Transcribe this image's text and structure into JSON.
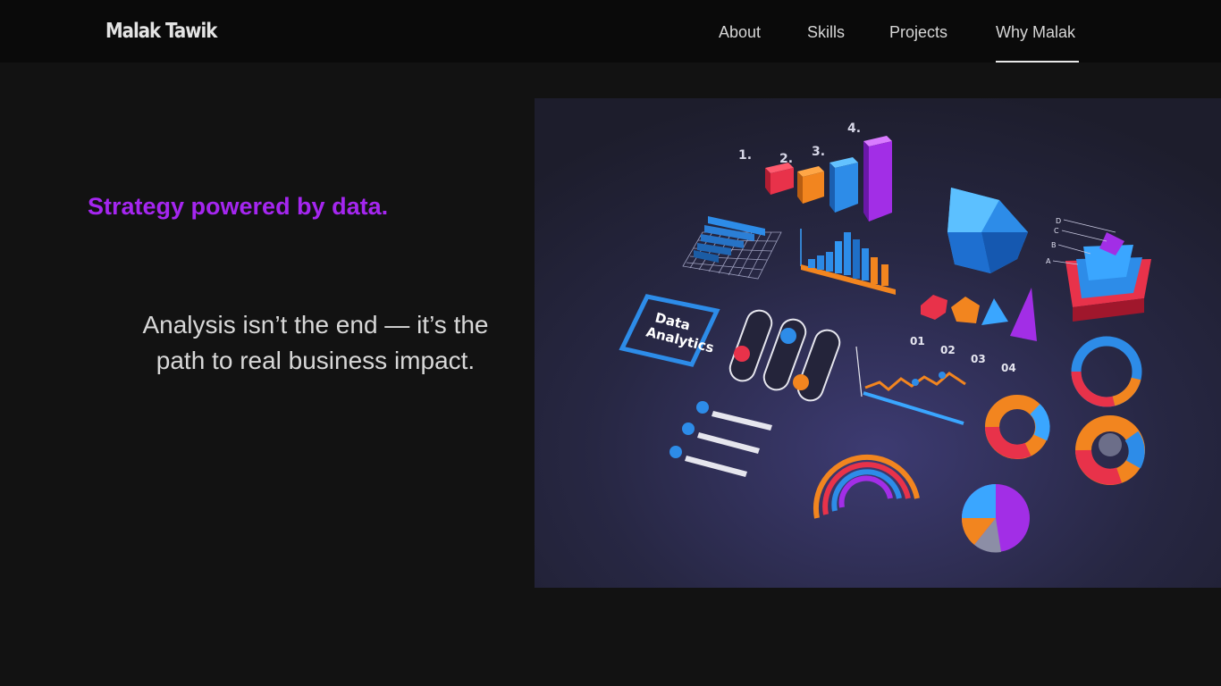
{
  "header": {
    "brand": "Malak Tawik",
    "nav": [
      {
        "label": "About"
      },
      {
        "label": "Skills"
      },
      {
        "label": "Projects"
      },
      {
        "label": "Why Malak",
        "active": true
      }
    ]
  },
  "hero": {
    "headline": "Strategy powered by data.",
    "tagline_line1": "Analysis isn’t the end — it’s the",
    "tagline_line2": "path to real business impact."
  },
  "illustration": {
    "badge_line1": "Data",
    "badge_line2": "Analytics",
    "rank_labels": [
      "1.",
      "2.",
      "3.",
      "4."
    ],
    "step_labels": [
      "01",
      "02",
      "03",
      "04"
    ],
    "pyramid_levels": [
      "D",
      "C",
      "B",
      "A"
    ]
  },
  "colors": {
    "background": "#121212",
    "navbar": "#0a0a0a",
    "accent_purple": "#a526f0",
    "text_light": "#d8d8d8"
  }
}
